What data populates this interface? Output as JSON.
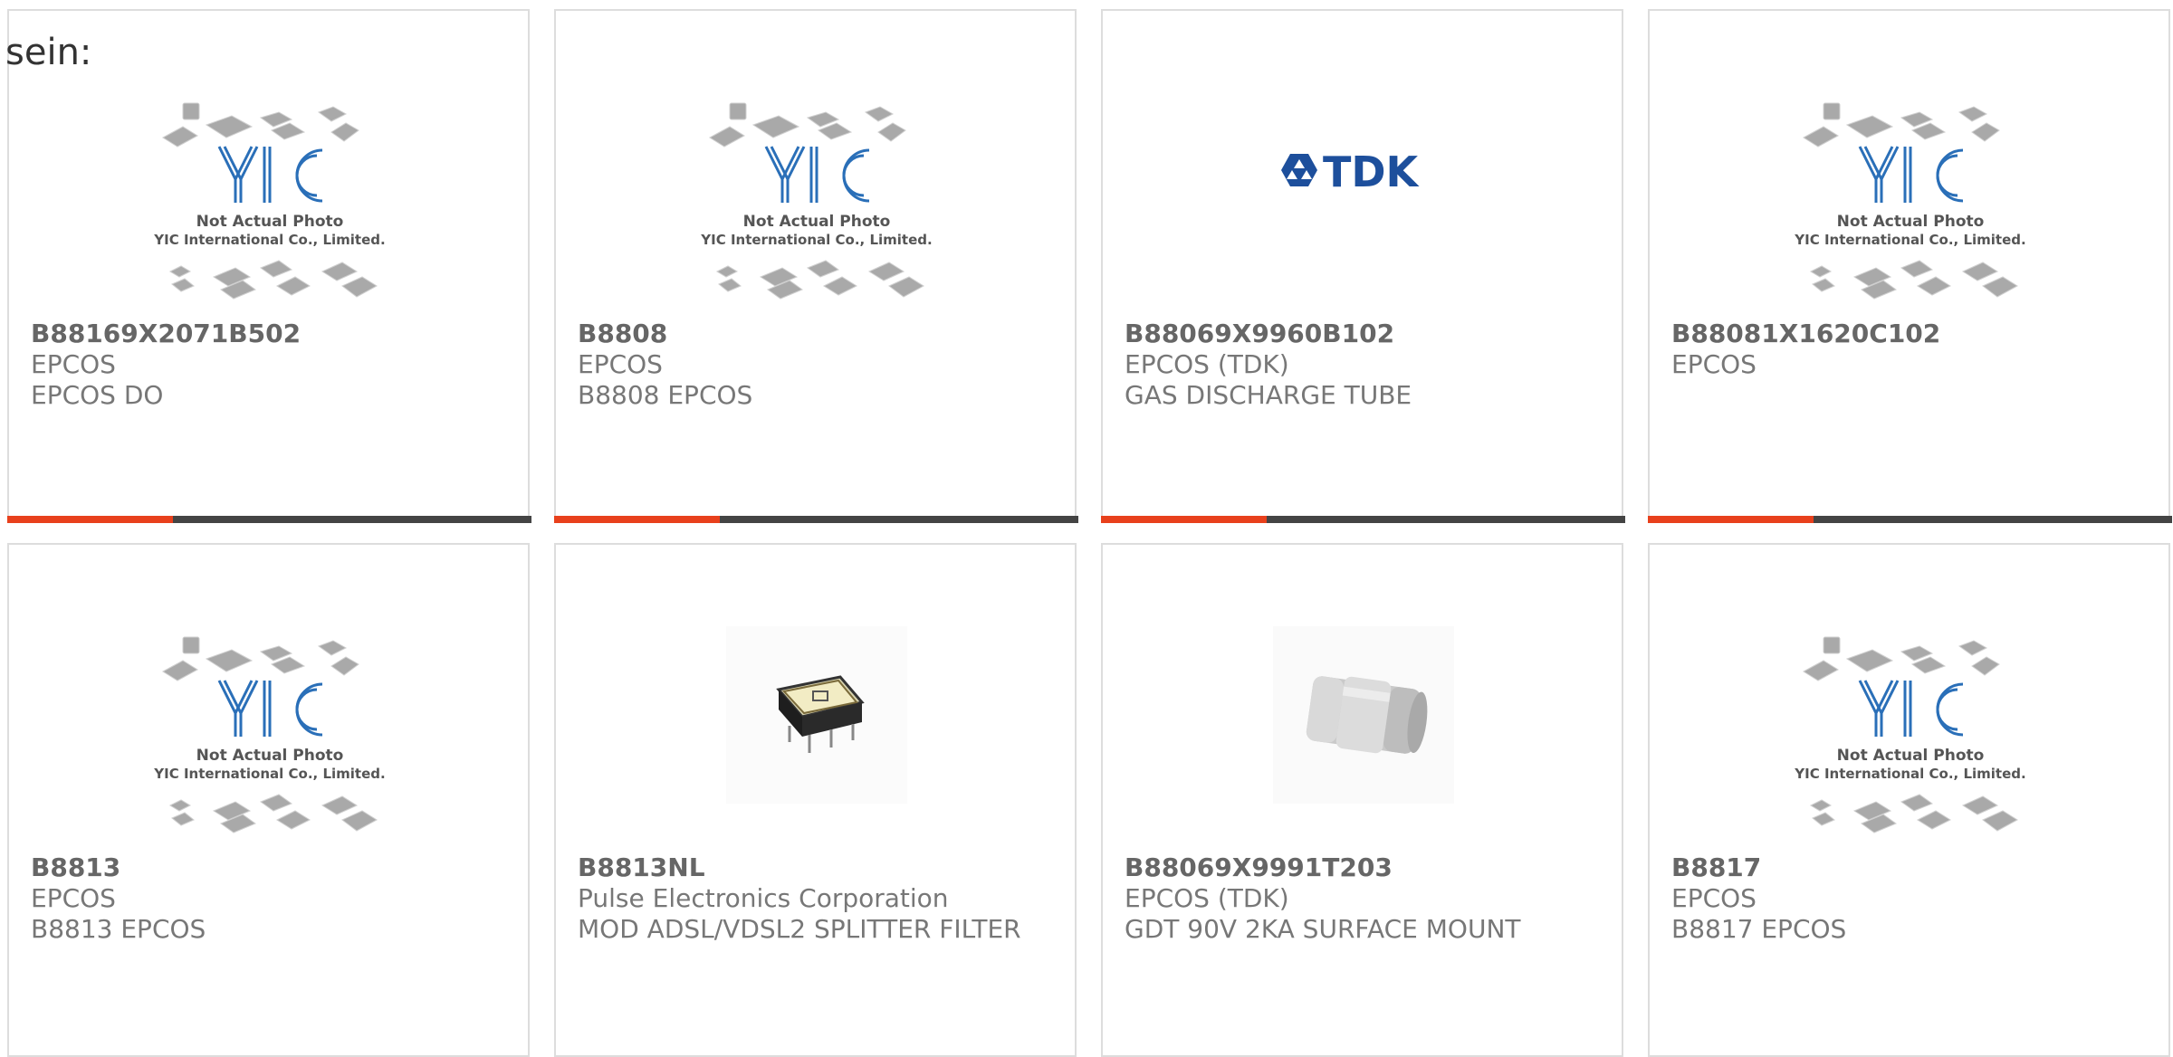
{
  "intro": "sein:",
  "colors": {
    "accent": "#e8401c",
    "bar": "#444444",
    "yic_blue": "#2a6fb8",
    "tdk_blue": "#1d4f9c"
  },
  "placeholder": {
    "line1": "Not Actual Photo",
    "line2": "YIC International Co., Limited."
  },
  "tdk_logo_text": "TDK",
  "products": [
    {
      "part": "B88169X2071B502",
      "mfr": "EPCOS",
      "desc": "EPCOS DO",
      "image": "placeholder"
    },
    {
      "part": "B8808",
      "mfr": "EPCOS",
      "desc": "B8808 EPCOS",
      "image": "placeholder"
    },
    {
      "part": "B88069X9960B102",
      "mfr": "EPCOS (TDK)",
      "desc": "GAS DISCHARGE TUBE",
      "image": "tdk-logo"
    },
    {
      "part": "B88081X1620C102",
      "mfr": "EPCOS",
      "desc": "",
      "image": "placeholder"
    },
    {
      "part": "B8813",
      "mfr": "EPCOS",
      "desc": "B8813 EPCOS",
      "image": "placeholder"
    },
    {
      "part": "B8813NL",
      "mfr": "Pulse Electronics Corporation",
      "desc": "MOD ADSL/VDSL2 SPLITTER FILTER",
      "image": "transformer-photo"
    },
    {
      "part": "B88069X9991T203",
      "mfr": "EPCOS (TDK)",
      "desc": "GDT 90V 2KA SURFACE MOUNT",
      "image": "gdt-photo"
    },
    {
      "part": "B8817",
      "mfr": "EPCOS",
      "desc": "B8817 EPCOS",
      "image": "placeholder"
    }
  ]
}
